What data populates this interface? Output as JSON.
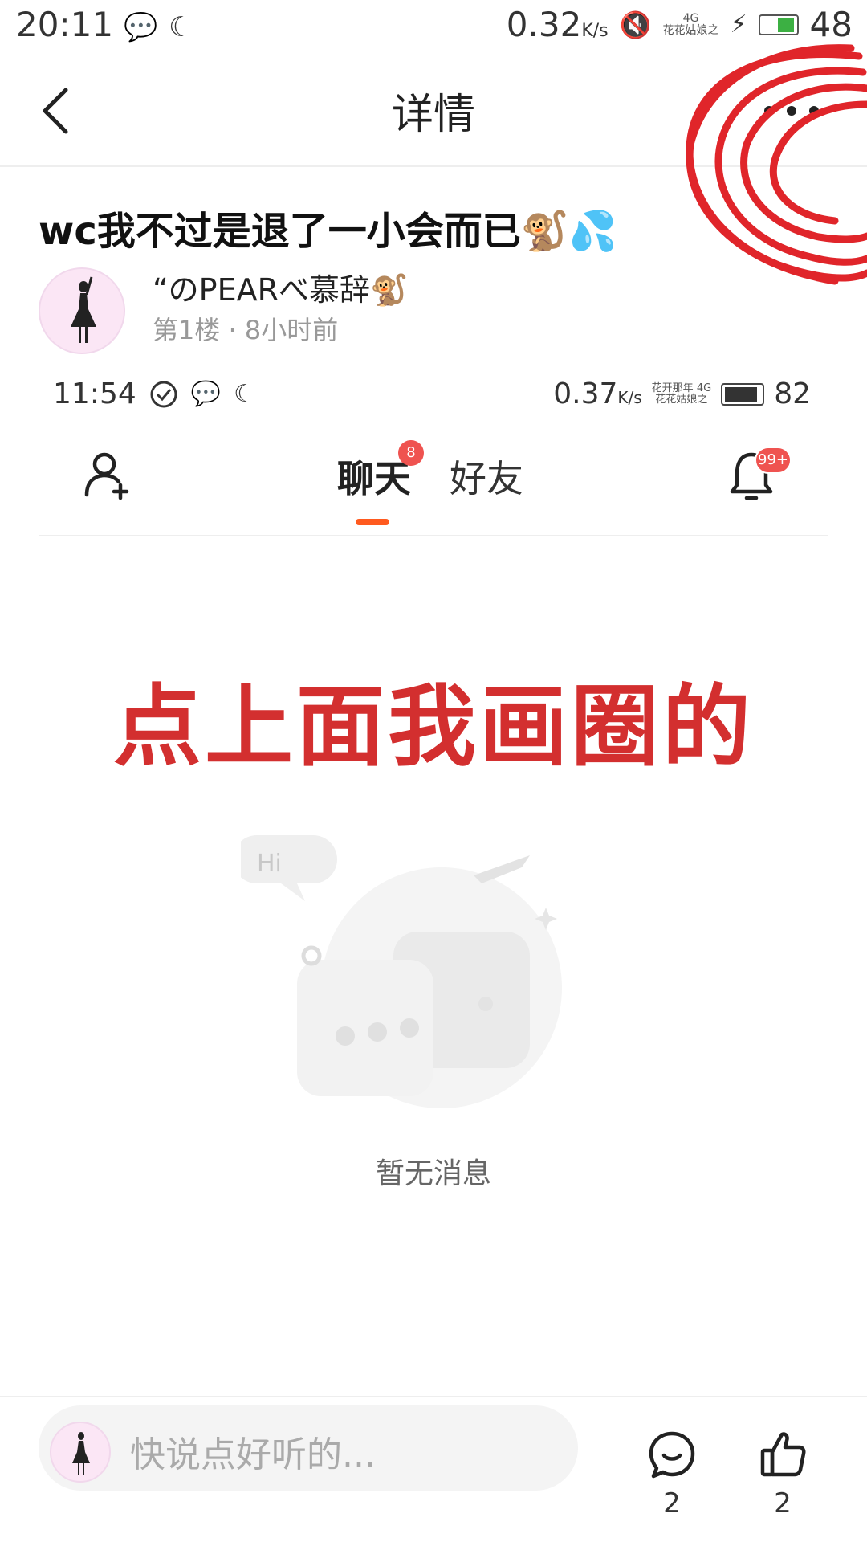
{
  "status_bar": {
    "time": "20:11",
    "speed": "0.32",
    "speed_unit": "K/s",
    "network": "4G",
    "carrier": "花花姑娘之",
    "battery": "48"
  },
  "header": {
    "title": "详情"
  },
  "post": {
    "title": "wc我不过是退了一小会而已🐒💦",
    "author": "“のPEARべ慕辞🐒",
    "meta": "第1楼 · 8小时前"
  },
  "inner_screenshot": {
    "status_time": "11:54",
    "speed": "0.37",
    "speed_unit": "K/s",
    "carrier_top": "花开那年",
    "network": "4G",
    "carrier": "花花姑娘之",
    "battery": "82",
    "tabs": [
      {
        "label": "聊天",
        "badge": "8"
      },
      {
        "label": "好友"
      }
    ],
    "bell_badge": "99+",
    "annotation": "点上面我画圈的",
    "hi_label": "Hi",
    "empty_text": "暂无消息"
  },
  "bottom_bar": {
    "placeholder": "快说点好听的...",
    "comment_count": "2",
    "like_count": "2"
  },
  "colors": {
    "annotation_red": "#d32f2f",
    "tab_indicator": "#ff5a1f",
    "badge_red": "#ef5350"
  }
}
